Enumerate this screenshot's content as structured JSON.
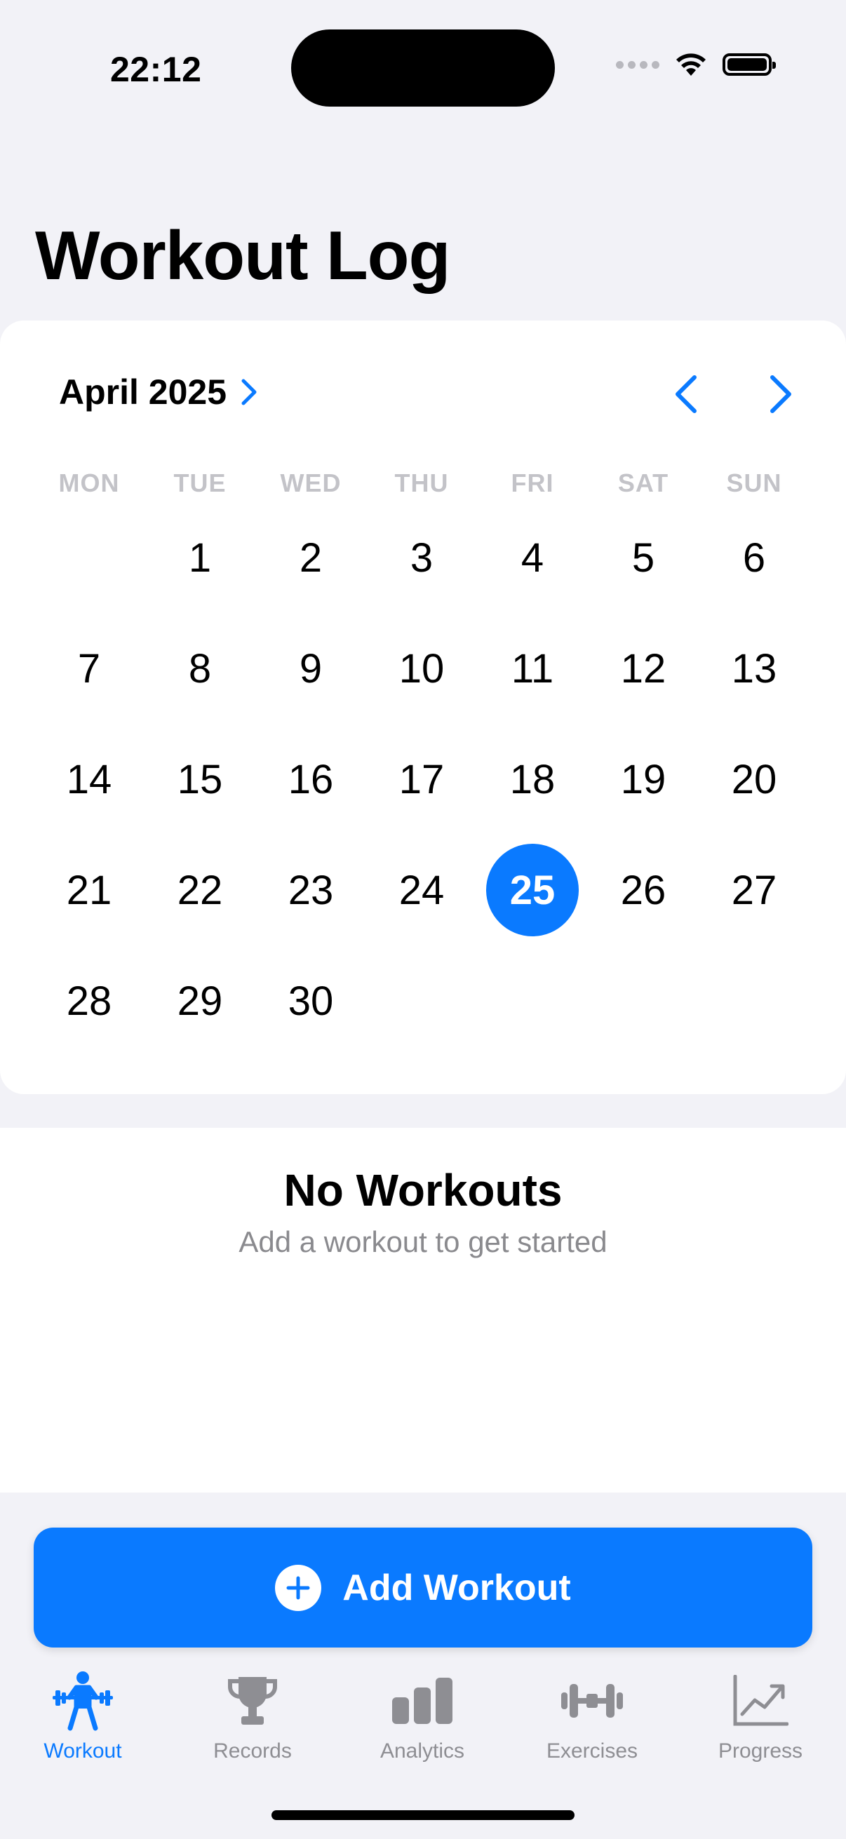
{
  "status_bar": {
    "time": "22:12"
  },
  "page_title": "Workout Log",
  "calendar": {
    "month_label": "April 2025",
    "weekdays": [
      "MON",
      "TUE",
      "WED",
      "THU",
      "FRI",
      "SAT",
      "SUN"
    ],
    "selected_day": "25",
    "weeks": [
      [
        "",
        "1",
        "2",
        "3",
        "4",
        "5",
        "6"
      ],
      [
        "7",
        "8",
        "9",
        "10",
        "11",
        "12",
        "13"
      ],
      [
        "14",
        "15",
        "16",
        "17",
        "18",
        "19",
        "20"
      ],
      [
        "21",
        "22",
        "23",
        "24",
        "25",
        "26",
        "27"
      ],
      [
        "28",
        "29",
        "30",
        "",
        "",
        "",
        ""
      ]
    ]
  },
  "empty_state": {
    "title": "No Workouts",
    "subtitle": "Add a workout to get started"
  },
  "add_button_label": "Add Workout",
  "tabs": [
    {
      "label": "Workout",
      "icon": "weightlifter-icon",
      "active": true
    },
    {
      "label": "Records",
      "icon": "trophy-icon",
      "active": false
    },
    {
      "label": "Analytics",
      "icon": "bar-chart-icon",
      "active": false
    },
    {
      "label": "Exercises",
      "icon": "dumbbell-icon",
      "active": false
    },
    {
      "label": "Progress",
      "icon": "line-chart-icon",
      "active": false
    }
  ],
  "colors": {
    "accent": "#0a7aff",
    "background": "#f2f2f7",
    "inactive": "#8e8e93"
  }
}
